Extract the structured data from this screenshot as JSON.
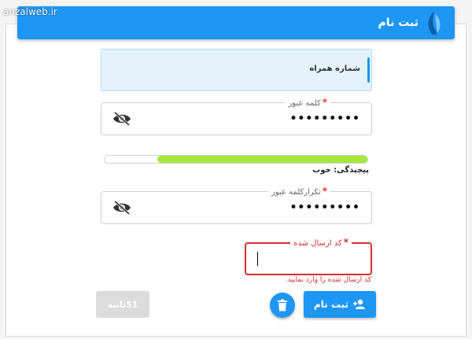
{
  "watermark": "anzalweb.ir",
  "header": {
    "title": "ثبت نام",
    "logo_icon": "leaf-logo"
  },
  "phone": {
    "label": "شماره همراه"
  },
  "password": {
    "label": "کلمه عبور",
    "required_mark": "*",
    "value": "•••••••••",
    "toggle_icon": "eye-off-icon"
  },
  "strength": {
    "level": 0.8,
    "text": "پیچیدگی: خوب",
    "fill_color": "#a6e83a"
  },
  "repeat_password": {
    "label": "تکرارکلمه عبور",
    "required_mark": "*",
    "value": "•••••••••",
    "toggle_icon": "eye-off-icon"
  },
  "code": {
    "label": "کد ارسال شده",
    "required_mark": "*",
    "value": "",
    "error": "کد ارسال شده را وارد نمایید."
  },
  "buttons": {
    "submit": "ثبت نام",
    "timer": "51ثانیه",
    "delete_icon": "trash-icon",
    "submit_icon": "user-add-icon"
  },
  "colors": {
    "primary": "#1e96f3",
    "error": "#d32f2f"
  }
}
